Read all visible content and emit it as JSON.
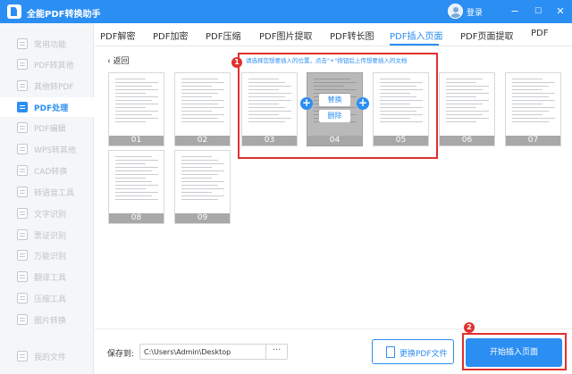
{
  "app": {
    "title": "全能PDF转换助手",
    "login_label": "登录"
  },
  "window": {
    "min": "−",
    "max": "☐",
    "close": "✕"
  },
  "sidebar": {
    "items": [
      {
        "label": "常用功能",
        "active": false
      },
      {
        "label": "PDF转其他",
        "active": false
      },
      {
        "label": "其他转PDF",
        "active": false
      },
      {
        "label": "PDF处理",
        "active": true
      },
      {
        "label": "PDF编辑",
        "active": false
      },
      {
        "label": "WPS转其他",
        "active": false
      },
      {
        "label": "CAD转换",
        "active": false
      },
      {
        "label": "转语音工具",
        "active": false
      },
      {
        "label": "文字识别",
        "active": false
      },
      {
        "label": "票证识别",
        "active": false
      },
      {
        "label": "万能识别",
        "active": false
      },
      {
        "label": "翻译工具",
        "active": false
      },
      {
        "label": "压缩工具",
        "active": false
      },
      {
        "label": "图片转换",
        "active": false
      },
      {
        "label": "我的文件",
        "active": false
      }
    ]
  },
  "tabs": [
    {
      "label": "PDF解密"
    },
    {
      "label": "PDF加密"
    },
    {
      "label": "PDF压缩"
    },
    {
      "label": "PDF图片提取"
    },
    {
      "label": "PDF转长图"
    },
    {
      "label": "PDF插入页面",
      "active": true
    },
    {
      "label": "PDF页面提取"
    },
    {
      "label": "PDF"
    }
  ],
  "back_label": "返回",
  "hint": "请选择您想要插入的位置，点击\"+\"按钮后上传想要插入的文档",
  "pages": [
    "01",
    "02",
    "03",
    "04",
    "05",
    "06",
    "07",
    "08",
    "09"
  ],
  "popup": {
    "select": "替换",
    "delete": "删除"
  },
  "plus": "+",
  "badges": [
    "1",
    "2"
  ],
  "bottom": {
    "save_label": "保存到:",
    "save_path": "C:\\Users\\Admin\\Desktop",
    "browse": "···",
    "change_label": "更换PDF文件",
    "start_label": "开始插入页面"
  },
  "colors": {
    "accent": "#2b8ef2",
    "highlight": "#e0312f"
  }
}
